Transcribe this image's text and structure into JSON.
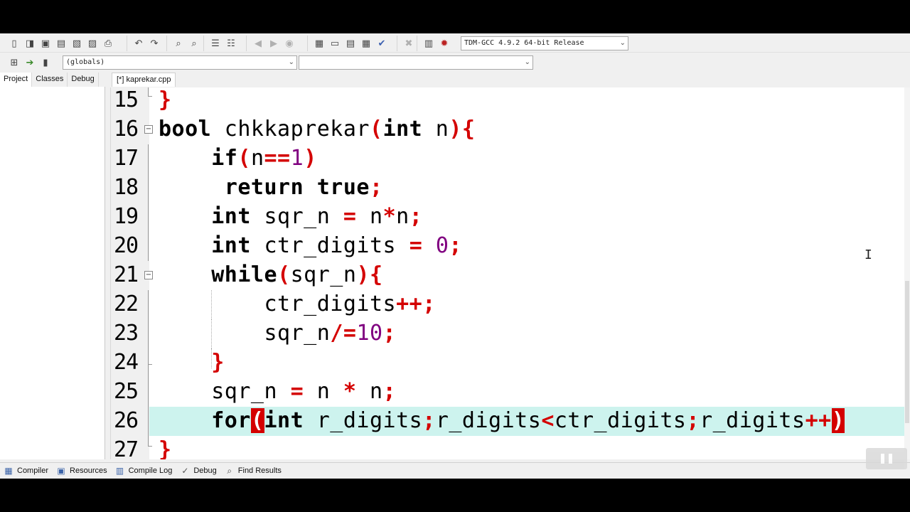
{
  "toolbar": {
    "compiler_select": "TDM-GCC 4.9.2 64-bit Release",
    "globals_select": "(globals)",
    "function_select": ""
  },
  "left_panel": {
    "tabs": [
      "Project",
      "Classes",
      "Debug"
    ],
    "active_tab": "Project"
  },
  "editor": {
    "file_tab": "[*] kaprekar.cpp",
    "lines": [
      {
        "num": "15"
      },
      {
        "num": "16"
      },
      {
        "num": "17"
      },
      {
        "num": "18"
      },
      {
        "num": "19"
      },
      {
        "num": "20"
      },
      {
        "num": "21"
      },
      {
        "num": "22"
      },
      {
        "num": "23"
      },
      {
        "num": "24"
      },
      {
        "num": "25"
      },
      {
        "num": "26"
      },
      {
        "num": "27"
      }
    ],
    "active_line": "26"
  },
  "bottom_tabs": [
    "Compiler",
    "Resources",
    "Compile Log",
    "Debug",
    "Find Results"
  ],
  "colors": {
    "keyword": "#000000",
    "operator": "#d40000",
    "number": "#800080",
    "active_line_bg": "#cdf3ee"
  }
}
